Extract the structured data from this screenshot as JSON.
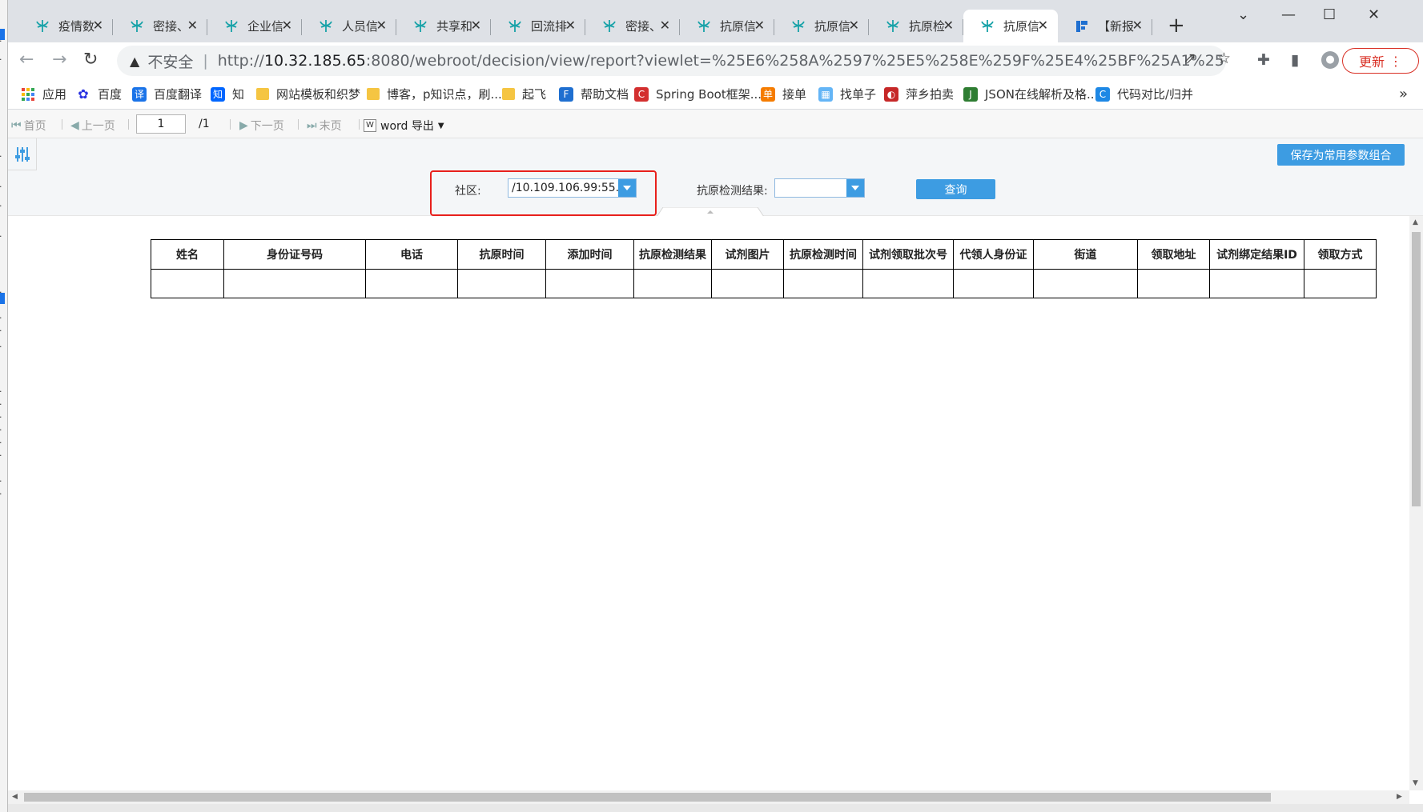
{
  "tabs": [
    {
      "label": "疫情数",
      "active": false
    },
    {
      "label": "密接、",
      "active": false
    },
    {
      "label": "企业信",
      "active": false
    },
    {
      "label": "人员信",
      "active": false
    },
    {
      "label": "共享和",
      "active": false
    },
    {
      "label": "回流排",
      "active": false
    },
    {
      "label": "密接、",
      "active": false
    },
    {
      "label": "抗原信",
      "active": false
    },
    {
      "label": "抗原信",
      "active": false
    },
    {
      "label": "抗原检",
      "active": false
    },
    {
      "label": "抗原信",
      "active": true
    },
    {
      "label": "【新报",
      "active": false
    }
  ],
  "window_controls": {
    "minimize": "—",
    "maximize": "☐",
    "close": "✕",
    "tab_list": "⌄"
  },
  "address_bar": {
    "security_label": "不安全",
    "url_host": "10.32.185.65",
    "url_prefix": "http://",
    "url_rest": ":8080/webroot/decision/view/report?viewlet=%25E6%258A%2597%25E5%258E%259F%25E4%25BF%25A1%25E6%2581%..."
  },
  "update_button": "更新",
  "bookmarks": [
    {
      "label": "应用",
      "icon": "apps-grid-icon",
      "color": "#e8453c"
    },
    {
      "label": "百度",
      "icon": "baidu-paw-icon",
      "color": "#2932e1"
    },
    {
      "label": "百度翻译",
      "icon": "translate-icon",
      "color": "#1a73e8",
      "glyph": "译"
    },
    {
      "label": "知",
      "icon": "zhihu-icon",
      "color": "#0066ff",
      "glyph": "知"
    },
    {
      "label": "网站模板和织梦",
      "icon": "folder-icon",
      "color": "#f5c542"
    },
    {
      "label": "博客，p知识点，刷...",
      "icon": "folder-icon",
      "color": "#f5c542"
    },
    {
      "label": "起飞",
      "icon": "folder-icon",
      "color": "#f5c542"
    },
    {
      "label": "帮助文档",
      "icon": "finereport-icon",
      "color": "#1f6fd0",
      "glyph": "F"
    },
    {
      "label": "Spring Boot框架...",
      "icon": "csdn-icon",
      "color": "#d32f2f",
      "glyph": "C"
    },
    {
      "label": "接单",
      "icon": "order-icon",
      "color": "#f57c00",
      "glyph": "单"
    },
    {
      "label": "找单子",
      "icon": "grid-icon",
      "color": "#64b5f6",
      "glyph": "▦"
    },
    {
      "label": "萍乡拍卖",
      "icon": "auction-icon",
      "color": "#c62828",
      "glyph": "◐"
    },
    {
      "label": "JSON在线解析及格...",
      "icon": "json-icon",
      "color": "#2e7d32",
      "glyph": "J"
    },
    {
      "label": "代码对比/归并",
      "icon": "compare-icon",
      "color": "#1e88e5",
      "glyph": "C"
    }
  ],
  "bookmarks_more": "»",
  "report_toolbar": {
    "first": "首页",
    "prev": "上一页",
    "page_value": "1",
    "page_total": "/1",
    "next": "下一页",
    "last": "末页",
    "export": "word 导出"
  },
  "params": {
    "save_button": "保存为常用参数组合",
    "community_label": "社区:",
    "community_value": "/10.109.106.99:55...",
    "result_label": "抗原检测结果:",
    "result_value": "",
    "query_button": "查询"
  },
  "table": {
    "columns": [
      "姓名",
      "身份证号码",
      "电话",
      "抗原时间",
      "添加时间",
      "抗原检测结果",
      "试剂图片",
      "抗原检测时间",
      "试剂领取批次号",
      "代领人身份证",
      "街道",
      "领取地址",
      "试剂绑定结果ID",
      "领取方式"
    ],
    "rows": [
      [
        "",
        "",
        "",
        "",
        "",
        "",
        "",
        "",
        "",
        "",
        "",
        "",
        "",
        ""
      ]
    ]
  },
  "colors": {
    "accent_blue": "#3d9ce2",
    "highlight_red": "#e8201c",
    "update_red": "#d93025",
    "tab_icon_teal": "#17a2a8"
  }
}
